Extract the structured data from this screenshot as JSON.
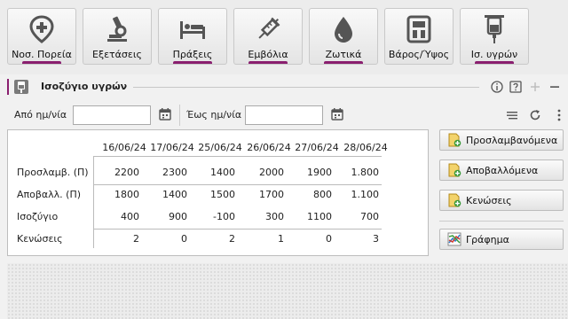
{
  "toolbar": {
    "buttons": [
      {
        "label": "Νοσ. Πορεία",
        "icon": "location-pin-cross-icon"
      },
      {
        "label": "Εξετάσεις",
        "icon": "microscope-icon"
      },
      {
        "label": "Πράξεις",
        "icon": "hospital-bed-icon"
      },
      {
        "label": "Εμβόλια",
        "icon": "syringe-icon"
      },
      {
        "label": "Ζωτικά",
        "icon": "blood-drop-icon"
      },
      {
        "label": "Βάρος/Ύψος",
        "icon": "weight-scale-icon"
      },
      {
        "label": "Ισ. υγρών",
        "icon": "iv-bag-icon"
      }
    ],
    "accent_color": "#8a1f6f"
  },
  "section": {
    "title": "Ισοζύγιο υγρών",
    "icons": [
      "info-icon",
      "help-icon",
      "add-icon",
      "minimize-icon"
    ]
  },
  "filters": {
    "from_label": "Από ημ/νία",
    "from_value": "",
    "to_label": "Έως ημ/νία",
    "to_value": ""
  },
  "table": {
    "columns": [
      "16/06/24",
      "17/06/24",
      "25/06/24",
      "26/06/24",
      "27/06/24",
      "28/06/24"
    ],
    "rows": [
      {
        "label": "Προσλαμβ. (Π)",
        "values": [
          "2200",
          "2300",
          "1400",
          "2000",
          "1900",
          "1.800"
        ]
      },
      {
        "label": "Αποβαλλ. (Π)",
        "values": [
          "1800",
          "1400",
          "1500",
          "1700",
          "800",
          "1.100"
        ]
      },
      {
        "label": "Ισοζύγιο",
        "values": [
          "400",
          "900",
          "-100",
          "300",
          "1100",
          "700"
        ]
      },
      {
        "label": "Κενώσεις",
        "values": [
          "2",
          "0",
          "2",
          "1",
          "0",
          "3"
        ]
      }
    ]
  },
  "actions": {
    "intake": "Προσλαμβανόμενα",
    "output": "Αποβαλλόμενα",
    "bowel": "Κενώσεις",
    "chart": "Γράφημα"
  }
}
